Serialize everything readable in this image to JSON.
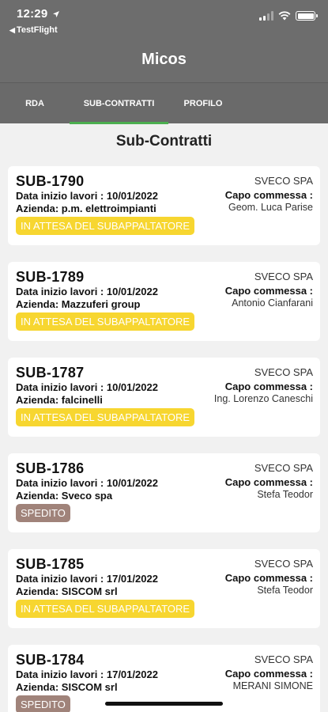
{
  "status_bar": {
    "time": "12:29",
    "back_app": "TestFlight"
  },
  "app": {
    "title": "Micos"
  },
  "tabs": [
    {
      "label": "RDA"
    },
    {
      "label": "SUB-CONTRATTI"
    },
    {
      "label": "PROFILO"
    }
  ],
  "page_title": "Sub-Contratti",
  "colors": {
    "header_bg": "#6d6d6d",
    "active_tab_indicator": "#4caf50",
    "badge_waiting": "#f7d630",
    "badge_sent": "#a0837a"
  },
  "contracts": [
    {
      "code": "SUB-1790",
      "company": "SVECO SPA",
      "date_line": "Data inizio lavori : 10/01/2022",
      "azienda_line": "Azienda: p.m. elettroimpianti",
      "capo_label": "Capo commessa :",
      "capo_name": "Geom. Luca Parise",
      "status": "IN ATTESA DEL SUBAPPALTATORE",
      "status_type": "waiting"
    },
    {
      "code": "SUB-1789",
      "company": "SVECO SPA",
      "date_line": "Data inizio lavori : 10/01/2022",
      "azienda_line": "Azienda: Mazzuferi group",
      "capo_label": "Capo commessa :",
      "capo_name": "Antonio Cianfarani",
      "status": "IN ATTESA DEL SUBAPPALTATORE",
      "status_type": "waiting"
    },
    {
      "code": "SUB-1787",
      "company": "SVECO SPA",
      "date_line": "Data inizio lavori : 10/01/2022",
      "azienda_line": "Azienda: falcinelli",
      "capo_label": "Capo commessa :",
      "capo_name": "Ing. Lorenzo Caneschi",
      "status": "IN ATTESA DEL SUBAPPALTATORE",
      "status_type": "waiting"
    },
    {
      "code": "SUB-1786",
      "company": "SVECO SPA",
      "date_line": "Data inizio lavori : 10/01/2022",
      "azienda_line": "Azienda: Sveco spa",
      "capo_label": "Capo commessa :",
      "capo_name": "Stefa Teodor",
      "status": "SPEDITO",
      "status_type": "sent"
    },
    {
      "code": "SUB-1785",
      "company": "SVECO SPA",
      "date_line": "Data inizio lavori : 17/01/2022",
      "azienda_line": "Azienda: SISCOM srl",
      "capo_label": "Capo commessa :",
      "capo_name": "Stefa Teodor",
      "status": "IN ATTESA DEL SUBAPPALTATORE",
      "status_type": "waiting"
    },
    {
      "code": "SUB-1784",
      "company": "SVECO SPA",
      "date_line": "Data inizio lavori : 17/01/2022",
      "azienda_line": "Azienda: SISCOM srl",
      "capo_label": "Capo commessa :",
      "capo_name": "MERANI SIMONE",
      "status": "SPEDITO",
      "status_type": "sent"
    }
  ]
}
